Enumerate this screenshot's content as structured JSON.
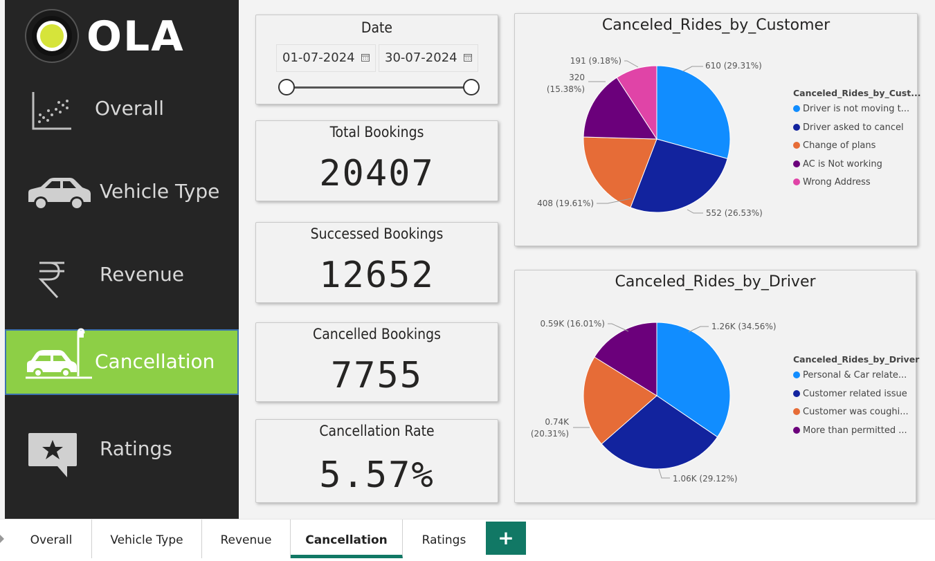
{
  "brand": {
    "logo_text": "OLA",
    "accent": "#d6e43a"
  },
  "sidebar": {
    "items": [
      {
        "label": "Overall",
        "icon": "scatter-chart-icon",
        "active": false
      },
      {
        "label": "Vehicle Type",
        "icon": "car-icon",
        "active": false
      },
      {
        "label": "Revenue",
        "icon": "rupee-icon",
        "active": false
      },
      {
        "label": "Cancellation",
        "icon": "car-crash-icon",
        "active": true
      },
      {
        "label": "Ratings",
        "icon": "star-comment-icon",
        "active": false
      }
    ],
    "active_color": "#8dcf46"
  },
  "date_filter": {
    "title": "Date",
    "start": "01-07-2024",
    "end": "30-07-2024"
  },
  "kpis": [
    {
      "title": "Total Bookings",
      "value": "20407"
    },
    {
      "title": "Successed Bookings",
      "value": "12652"
    },
    {
      "title": "Cancelled Bookings",
      "value": "7755"
    },
    {
      "title": "Cancellation Rate",
      "value": "5.57%"
    }
  ],
  "chart_data": [
    {
      "type": "pie",
      "title": "Canceled_Rides_by_Customer",
      "legend_title": "Canceled_Rides_by_Cust...",
      "legend_position": "right",
      "slices": [
        {
          "legend": "Driver is not moving t...",
          "value": 610,
          "label": "610 (29.31%)",
          "color": "#118dff"
        },
        {
          "legend": "Driver asked to cancel",
          "value": 552,
          "label": "552 (26.53%)",
          "color": "#12239e"
        },
        {
          "legend": "Change of plans",
          "value": 408,
          "label": "408 (19.61%)",
          "color": "#e66c37"
        },
        {
          "legend": "AC is Not working",
          "value": 320,
          "label_line1": "320",
          "label_line2": "(15.38%)",
          "color": "#6b007b"
        },
        {
          "legend": "Wrong Address",
          "value": 191,
          "label": "191 (9.18%)",
          "color": "#e044a7"
        }
      ]
    },
    {
      "type": "pie",
      "title": "Canceled_Rides_by_Driver",
      "legend_title": "Canceled_Rides_by_Driver",
      "legend_position": "right",
      "slices": [
        {
          "legend": "Personal & Car relate...",
          "value": 1.26,
          "label": "1.26K (34.56%)",
          "color": "#118dff"
        },
        {
          "legend": "Customer related issue",
          "value": 1.06,
          "label": "1.06K (29.12%)",
          "color": "#12239e"
        },
        {
          "legend": "Customer was coughi...",
          "value": 0.74,
          "label_line1": "0.74K",
          "label_line2": "(20.31%)",
          "color": "#e66c37"
        },
        {
          "legend": "More than permitted ...",
          "value": 0.59,
          "label": "0.59K (16.01%)",
          "color": "#6b007b"
        }
      ]
    }
  ],
  "tabs": [
    {
      "label": "Overall",
      "active": false
    },
    {
      "label": "Vehicle Type",
      "active": false
    },
    {
      "label": "Revenue",
      "active": false
    },
    {
      "label": "Cancellation",
      "active": true
    },
    {
      "label": "Ratings",
      "active": false
    }
  ],
  "add_tab_label": "+"
}
